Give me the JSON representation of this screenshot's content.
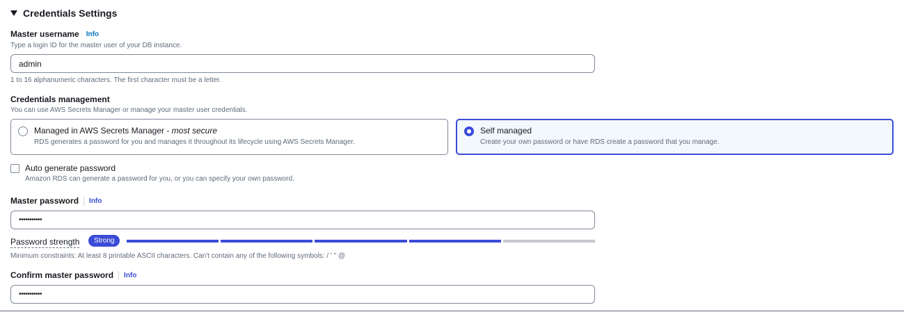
{
  "section": {
    "title": "Credentials Settings",
    "icon": "caret-down-icon"
  },
  "master_username": {
    "label": "Master username",
    "info": "Info",
    "description": "Type a login ID for the master user of your DB instance.",
    "value": "admin",
    "constraint": "1 to 16 alphanumeric characters. The first character must be a letter."
  },
  "credentials_management": {
    "label": "Credentials management",
    "description": "You can use AWS Secrets Manager or manage your master user credentials.",
    "options": [
      {
        "title": "Managed in AWS Secrets Manager - ",
        "title_emphasis": "most secure",
        "description": "RDS generates a password for you and manages it throughout its lifecycle using AWS Secrets Manager.",
        "selected": false
      },
      {
        "title": "Self managed",
        "title_emphasis": "",
        "description": "Create your own password or have RDS create a password that you manage.",
        "selected": true
      }
    ]
  },
  "auto_generate": {
    "label": "Auto generate password",
    "description": "Amazon RDS can generate a password for you, or you can specify your own password.",
    "checked": false
  },
  "master_password": {
    "label": "Master password",
    "info": "Info",
    "value": "•••••••••••",
    "strength_label": "Password strength",
    "strength_badge": "Strong",
    "strength_level": 0.8,
    "constraint": "Minimum constraints: At least 8 printable ASCII characters. Can't contain any of the following symbols: / ' \" @"
  },
  "confirm_password": {
    "label": "Confirm master password",
    "info": "Info",
    "value": "•••••••••••"
  },
  "colors": {
    "accent": "#3b4bd8",
    "link": "#0073bb",
    "bar_empty": "#c6c6cd",
    "selected_bg": "#f2f8fd"
  }
}
